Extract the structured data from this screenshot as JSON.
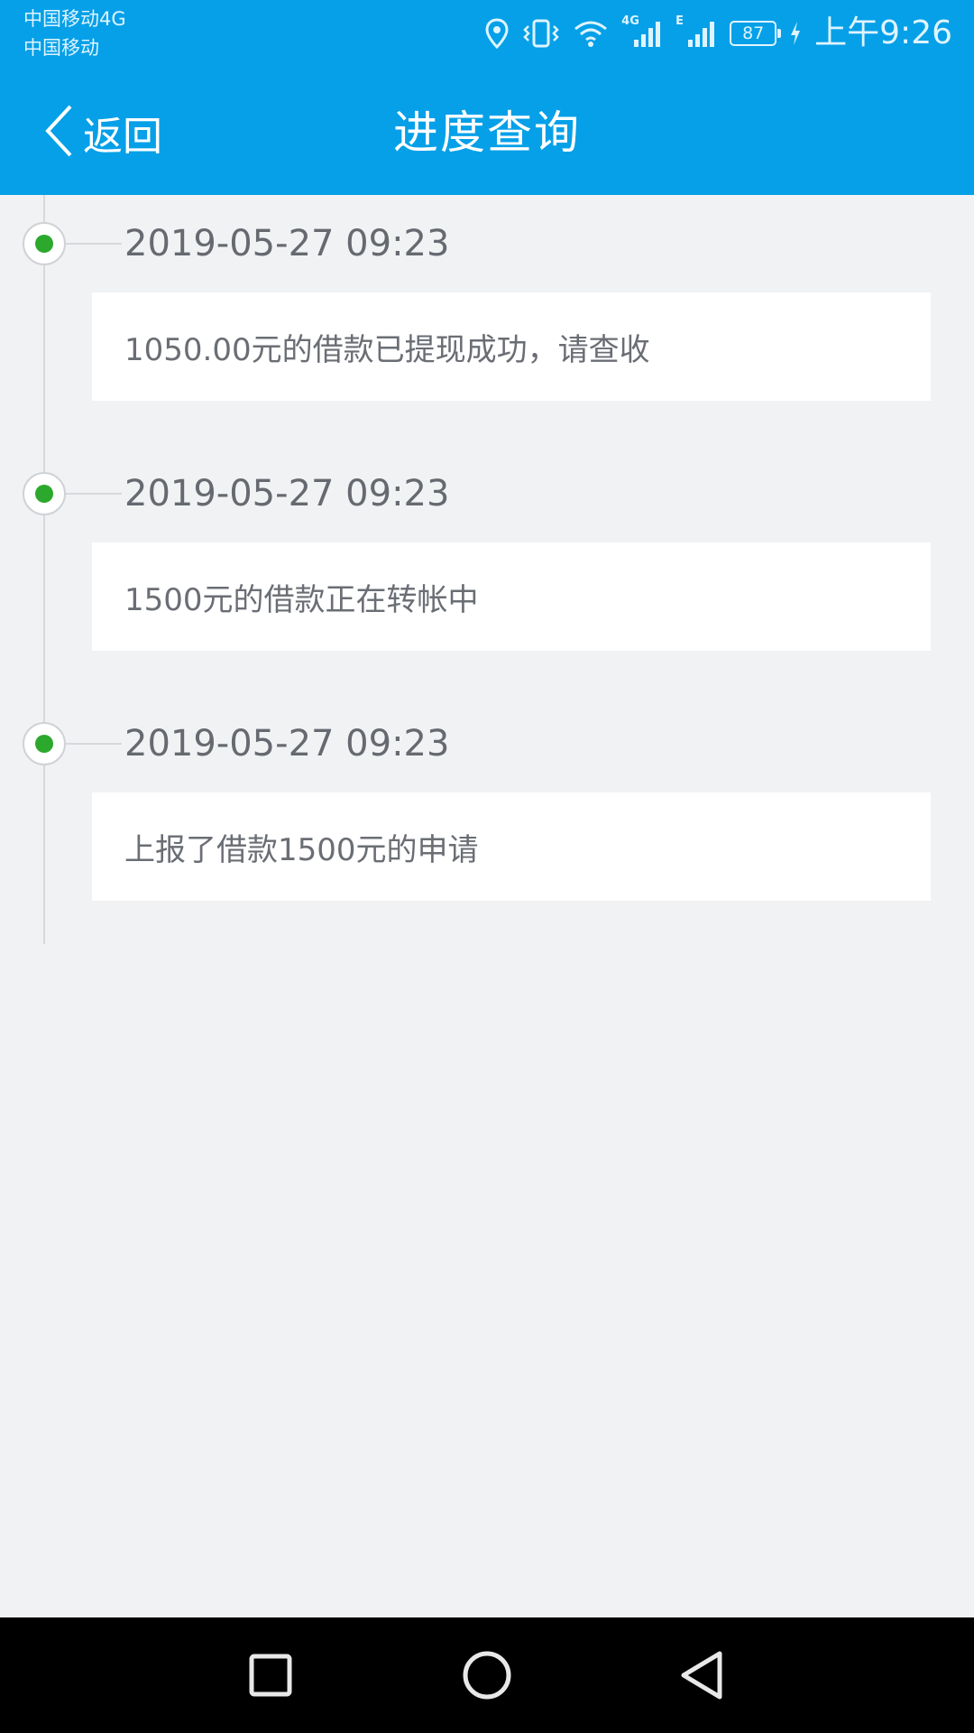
{
  "status_bar": {
    "carrier_1": "中国移动4G",
    "carrier_2": "中国移动",
    "network_1": "4G",
    "network_2": "E",
    "battery": "87",
    "time": "上午9:26",
    "icons": [
      "location-icon",
      "vibrate-icon",
      "wifi-icon",
      "signal-icon",
      "battery-icon",
      "charging-icon"
    ]
  },
  "nav": {
    "back_label": "返回",
    "title": "进度查询"
  },
  "timeline": [
    {
      "time": "2019-05-27 09:23",
      "message": "1050.00元的借款已提现成功，请查收"
    },
    {
      "time": "2019-05-27 09:23",
      "message": "1500元的借款正在转帐中"
    },
    {
      "time": "2019-05-27 09:23",
      "message": "上报了借款1500元的申请"
    }
  ],
  "colors": {
    "header": "#05a0e8",
    "background": "#f1f2f4",
    "dot": "#2ca82c",
    "card": "#ffffff"
  },
  "system_nav": {
    "icons": [
      "recents-square-icon",
      "home-circle-icon",
      "back-triangle-icon"
    ]
  }
}
